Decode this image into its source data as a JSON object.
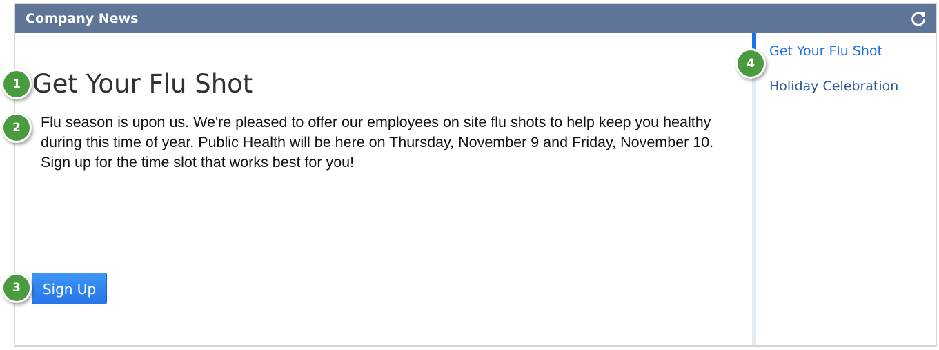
{
  "portlet": {
    "title": "Company News",
    "refresh_icon": "refresh-icon"
  },
  "article": {
    "title": "Get Your Flu Shot",
    "body": "Flu season is upon us. We're pleased to offer our employees on site flu shots to help keep you healthy during this time of year. Public Health will be here on Thursday, November 9 and Friday, November 10. Sign up for the time slot that works best for you!",
    "button_label": "Sign Up"
  },
  "sidebar": {
    "items": [
      {
        "label": "Get Your Flu Shot",
        "active": true
      },
      {
        "label": "Holiday Celebration",
        "active": false
      }
    ]
  },
  "callouts": [
    "1",
    "2",
    "3",
    "4"
  ],
  "colors": {
    "header": "#5f7598",
    "button": "#2675e8",
    "active_link": "#1a73e8",
    "callout": "#4a9b3f"
  }
}
